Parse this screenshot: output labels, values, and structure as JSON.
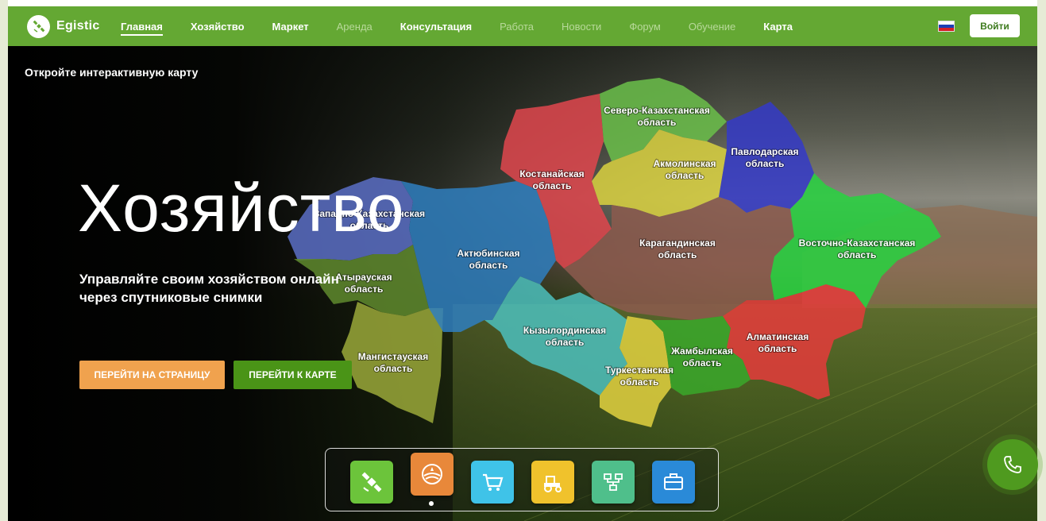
{
  "header": {
    "logo_text": "Egistic",
    "nav": [
      {
        "label": "Главная",
        "style": "active"
      },
      {
        "label": "Хозяйство",
        "style": "bright"
      },
      {
        "label": "Маркет",
        "style": "bright"
      },
      {
        "label": "Аренда",
        "style": "muted"
      },
      {
        "label": "Консультация",
        "style": "bright"
      },
      {
        "label": "Работа",
        "style": "muted"
      },
      {
        "label": "Новости",
        "style": "muted"
      },
      {
        "label": "Форум",
        "style": "muted"
      },
      {
        "label": "Обучение",
        "style": "muted"
      },
      {
        "label": "Карта",
        "style": "bright"
      }
    ],
    "language_icon": "russia-flag-icon",
    "login_label": "Войти"
  },
  "hero": {
    "open_map_link": "Откройте интерактивную карту",
    "title": "Хозяйство",
    "subtitle": "Управляйте своим хозяйством онлайн через спутниковые снимки",
    "page_button": "ПЕРЕЙТИ НА СТРАНИЦУ",
    "map_button": "ПЕРЕЙТИ К КАРТЕ"
  },
  "map": {
    "regions": [
      {
        "id": "west-kz",
        "line1": "Западно-Казахстанская",
        "line2": "область",
        "color": "#5b6fc6"
      },
      {
        "id": "atyrau",
        "line1": "Атырауская",
        "line2": "область",
        "color": "#5f8a2e"
      },
      {
        "id": "mangystau",
        "line1": "Мангистауская",
        "line2": "область",
        "color": "#9aa83a"
      },
      {
        "id": "aktobe",
        "line1": "Актюбинская",
        "line2": "область",
        "color": "#2f7fc0"
      },
      {
        "id": "kostanay",
        "line1": "Костанайская",
        "line2": "область",
        "color": "#e0464e"
      },
      {
        "id": "north-kz",
        "line1": "Северо-Казахстанская",
        "line2": "область",
        "color": "#6bbf4a"
      },
      {
        "id": "akmola",
        "line1": "Акмолинская",
        "line2": "область",
        "color": "#d9d13f"
      },
      {
        "id": "pavlodar",
        "line1": "Павлодарская",
        "line2": "область",
        "color": "#3439c8"
      },
      {
        "id": "karaganda",
        "line1": "Карагандинская",
        "line2": "область",
        "color": "#8c5a4e"
      },
      {
        "id": "east-kz",
        "line1": "Восточно-Казахстанская",
        "line2": "область",
        "color": "#27d33f"
      },
      {
        "id": "kyzylorda",
        "line1": "Кызылординская",
        "line2": "область",
        "color": "#4cc0bd"
      },
      {
        "id": "turkestan",
        "line1": "Туркестанская",
        "line2": "область",
        "color": "#e2d140"
      },
      {
        "id": "zhambyl",
        "line1": "Жамбылская",
        "line2": "область",
        "color": "#3aa82a"
      },
      {
        "id": "almaty",
        "line1": "Алматинская",
        "line2": "область",
        "color": "#e53b3b"
      }
    ]
  },
  "dock": {
    "items": [
      {
        "icon": "satellite-icon",
        "color": "#6cc43b"
      },
      {
        "icon": "farm-globe-icon",
        "color": "#e8883a"
      },
      {
        "icon": "shopping-cart-icon",
        "color": "#3fc3e8"
      },
      {
        "icon": "tractor-icon",
        "color": "#f0c22c"
      },
      {
        "icon": "consultation-icon",
        "color": "#4fbf8b"
      },
      {
        "icon": "briefcase-icon",
        "color": "#2a8ad8"
      }
    ]
  },
  "phone": {
    "icon": "phone-icon"
  }
}
